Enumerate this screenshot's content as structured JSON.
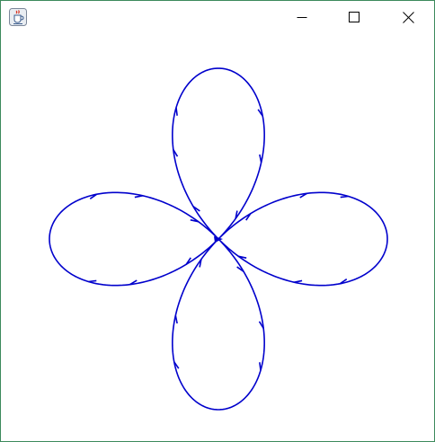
{
  "window": {
    "title": "",
    "border_color": "#3c8a5c"
  },
  "titlebar": {
    "app_icon": "java-coffee-cup-icon",
    "buttons": [
      {
        "icon": "minimize-icon"
      },
      {
        "icon": "maximize-icon"
      },
      {
        "icon": "close-icon"
      }
    ]
  },
  "canvas": {
    "shape": "four-petal rose curve with arrowheads",
    "stroke_color": "#0000cc",
    "background_color": "#ffffff"
  }
}
